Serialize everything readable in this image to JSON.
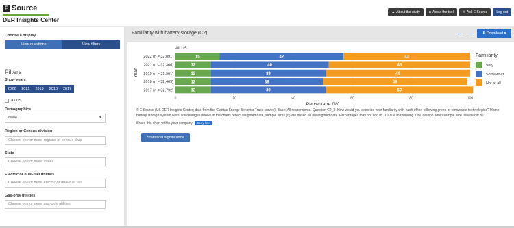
{
  "brand": {
    "logo_letter": "E",
    "name": "Source",
    "subtitle": "DER Insights Center"
  },
  "topnav": [
    {
      "label": "About the study",
      "icon": "graduation-icon"
    },
    {
      "label": "About the tool",
      "icon": "briefcase-icon"
    },
    {
      "label": "Ask E Source",
      "icon": "envelope-icon"
    },
    {
      "label": "Log out"
    }
  ],
  "sidebar": {
    "display_label": "Choose a display",
    "view_questions": "View questions",
    "view_filters": "View filters",
    "filters_heading": "Filters",
    "show_years_label": "Show years",
    "years": [
      "2022",
      "2021",
      "2019",
      "2018",
      "2017"
    ],
    "all_us_label": "All US",
    "demographics_label": "Demographics",
    "demographics_value": "None",
    "region_label": "Region or Census division",
    "region_placeholder": "Choose one or more regions or census divis",
    "state_label": "State",
    "state_placeholder": "Choose one or more states",
    "electric_label": "Electric or dual-fuel utilities",
    "electric_placeholder": "Choose one or more electric or dual-fuel utili",
    "gas_label": "Gas-only utilities",
    "gas_placeholder": "Choose one or more gas-only utilities"
  },
  "main": {
    "title": "Familiarity with battery storage (C2)",
    "download_label": "Download",
    "notes": "© E Source (US DER Insights Center; data from the Claritas Energy Behavior Track survey). Base: All respondents. Question C2_3: How would you describe your familiarity with each of the following green or renewable technologies? Home battery storage system Note: Percentages shown in the charts reflect weighted data, sample sizes (n) are based on unweighted data. Percentages may not add to 100 due to rounding. Use caution when sample size falls below 30.",
    "share_label": "Share this chart within your company",
    "copy_link_label": "Copy link",
    "stat_sig_label": "Statistical significance"
  },
  "colors": {
    "very": "#6aa84f",
    "somewhat": "#4472c4",
    "not_at_all": "#f39c1f"
  },
  "chart_data": {
    "type": "bar",
    "orientation": "horizontal",
    "stacked": true,
    "panel_title": "All US",
    "categories": [
      "2022 (n = 32,091)",
      "2021 (n = 32,366)",
      "2019 (n = 31,961)",
      "2018 (n = 32,469)",
      "2017 (n = 32,792)"
    ],
    "series": [
      {
        "name": "Very",
        "values": [
          15,
          12,
          12,
          12,
          12
        ]
      },
      {
        "name": "Somewhat",
        "values": [
          42,
          40,
          39,
          38,
          39
        ]
      },
      {
        "name": "Not at all",
        "values": [
          43,
          48,
          49,
          49,
          50
        ]
      }
    ],
    "xlabel": "Percentage (%)",
    "ylabel": "Year",
    "xlim": [
      0,
      100
    ],
    "xticks": [
      0,
      20,
      40,
      60,
      80,
      100
    ],
    "legend_title": "Familiarity",
    "legend_position": "right"
  }
}
